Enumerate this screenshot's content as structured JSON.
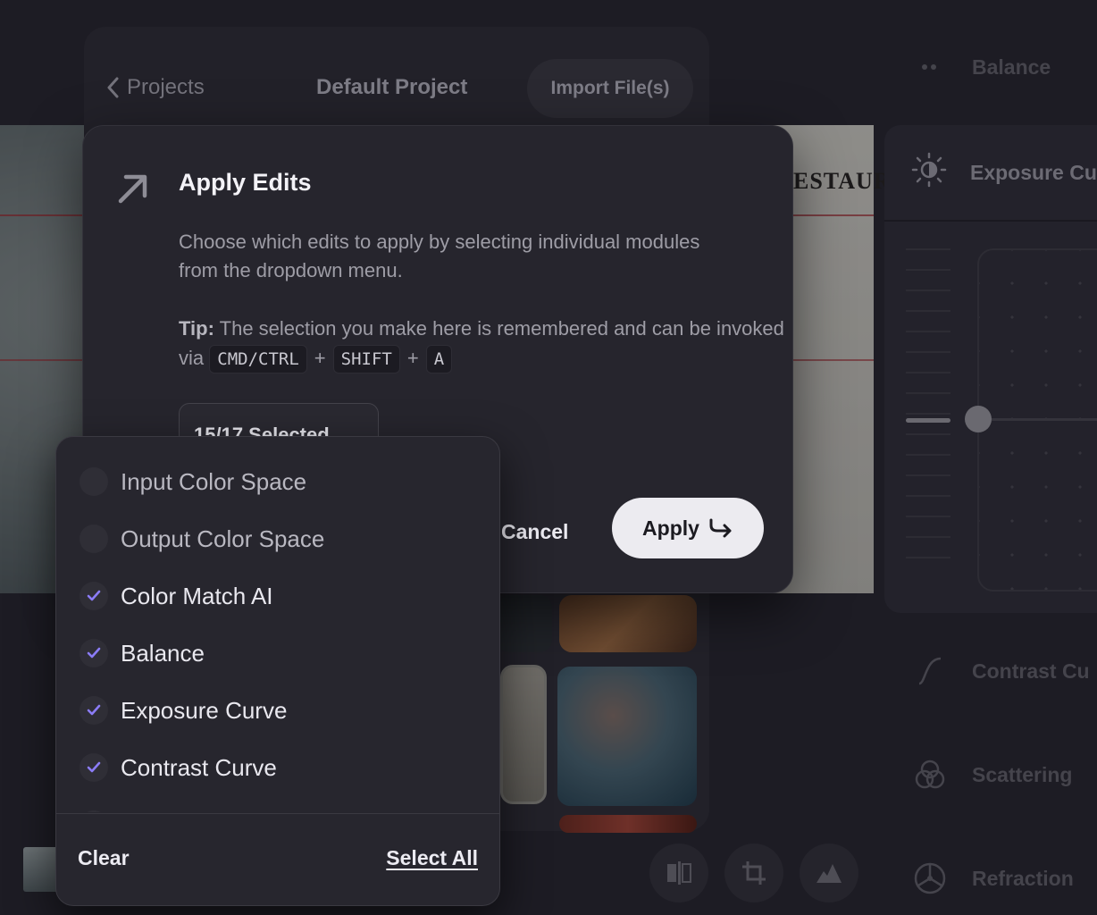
{
  "header": {
    "back_label": "Projects",
    "project_title": "Default Project",
    "import_label": "Import File(s)"
  },
  "preview": {
    "sign_text": "ESTAUR"
  },
  "right_panel": {
    "items": [
      {
        "label": "Balance",
        "icon": "dots-icon"
      },
      {
        "label": "Exposure Cu",
        "icon": "sun-exposure-icon"
      },
      {
        "label": "Contrast Cu",
        "icon": "curve-icon"
      },
      {
        "label": "Scattering",
        "icon": "circles-icon"
      },
      {
        "label": "Refraction",
        "icon": "nodes-icon"
      }
    ]
  },
  "modal": {
    "title": "Apply Edits",
    "description": "Choose which edits to apply by selecting individual modules from the dropdown menu.",
    "tip_label": "Tip:",
    "tip_text": "The selection you make here is remembered and can be invoked via",
    "shortcut": [
      "CMD/CTRL",
      "SHIFT",
      "A"
    ],
    "selection_label": "15/17 Selected",
    "cancel_label": "Cancel",
    "apply_label": "Apply"
  },
  "dropdown": {
    "items": [
      {
        "label": "Input Color Space",
        "checked": false
      },
      {
        "label": "Output Color Space",
        "checked": false
      },
      {
        "label": "Color Match AI",
        "checked": true
      },
      {
        "label": "Balance",
        "checked": true
      },
      {
        "label": "Exposure Curve",
        "checked": true
      },
      {
        "label": "Contrast Curve",
        "checked": true
      }
    ],
    "clear_label": "Clear",
    "select_all_label": "Select All"
  },
  "colors": {
    "accent_check": "#8b7cf6",
    "apply_bg": "#ecebf0",
    "modal_bg": "#26252d"
  }
}
